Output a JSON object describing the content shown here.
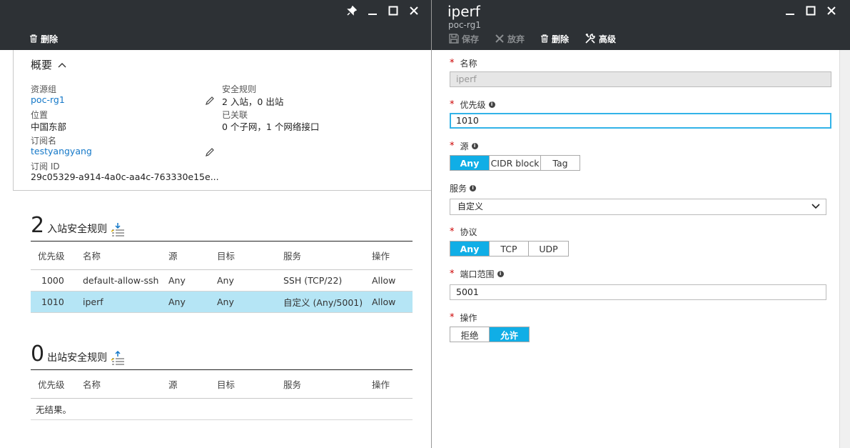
{
  "left_blade": {
    "commands": {
      "delete_label": "删除"
    },
    "essentials": {
      "title": "概要",
      "resource_group_label": "资源组",
      "resource_group_value": "poc-rg1",
      "location_label": "位置",
      "location_value": "中国东部",
      "subscription_label": "订阅名",
      "subscription_value": "testyangyang",
      "subscription_id_label": "订阅 ID",
      "subscription_id_value": "29c05329-a914-4a0c-aa4c-763330e15e...",
      "security_rules_label": "安全规则",
      "security_rules_value": "2 入站，0 出站",
      "associated_label": "已关联",
      "associated_value": "0 个子网，1 个网络接口"
    },
    "inbound": {
      "count": "2",
      "title": "入站安全规则",
      "columns": [
        "优先级",
        "名称",
        "源",
        "目标",
        "服务",
        "操作"
      ],
      "rows": [
        {
          "priority": "1000",
          "name": "default-allow-ssh",
          "source": "Any",
          "destination": "Any",
          "service": "SSH (TCP/22)",
          "action": "Allow"
        },
        {
          "priority": "1010",
          "name": "iperf",
          "source": "Any",
          "destination": "Any",
          "service": "自定义 (Any/5001)",
          "action": "Allow"
        }
      ]
    },
    "outbound": {
      "count": "0",
      "title": "出站安全规则",
      "columns": [
        "优先级",
        "名称",
        "源",
        "目标",
        "服务",
        "操作"
      ],
      "empty_text": "无结果。"
    }
  },
  "right_blade": {
    "title": "iperf",
    "subtitle": "poc-rg1",
    "commands": {
      "save_label": "保存",
      "discard_label": "放弃",
      "delete_label": "删除",
      "advanced_label": "高级"
    },
    "form": {
      "name_label": "名称",
      "name_value": "iperf",
      "priority_label": "优先级",
      "priority_value": "1010",
      "source_label": "源",
      "source_options": [
        "Any",
        "CIDR block",
        "Tag"
      ],
      "service_label": "服务",
      "service_value": "自定义",
      "protocol_label": "协议",
      "protocol_options": [
        "Any",
        "TCP",
        "UDP"
      ],
      "port_range_label": "端口范围",
      "port_range_value": "5001",
      "action_label": "操作",
      "action_options": [
        "拒绝",
        "允许"
      ]
    }
  },
  "colors": {
    "header_bg": "#2d3135",
    "accent": "#10aee6",
    "link": "#1478c8",
    "allow": "#2ec12e",
    "selected_row": "#b5e5f5"
  }
}
